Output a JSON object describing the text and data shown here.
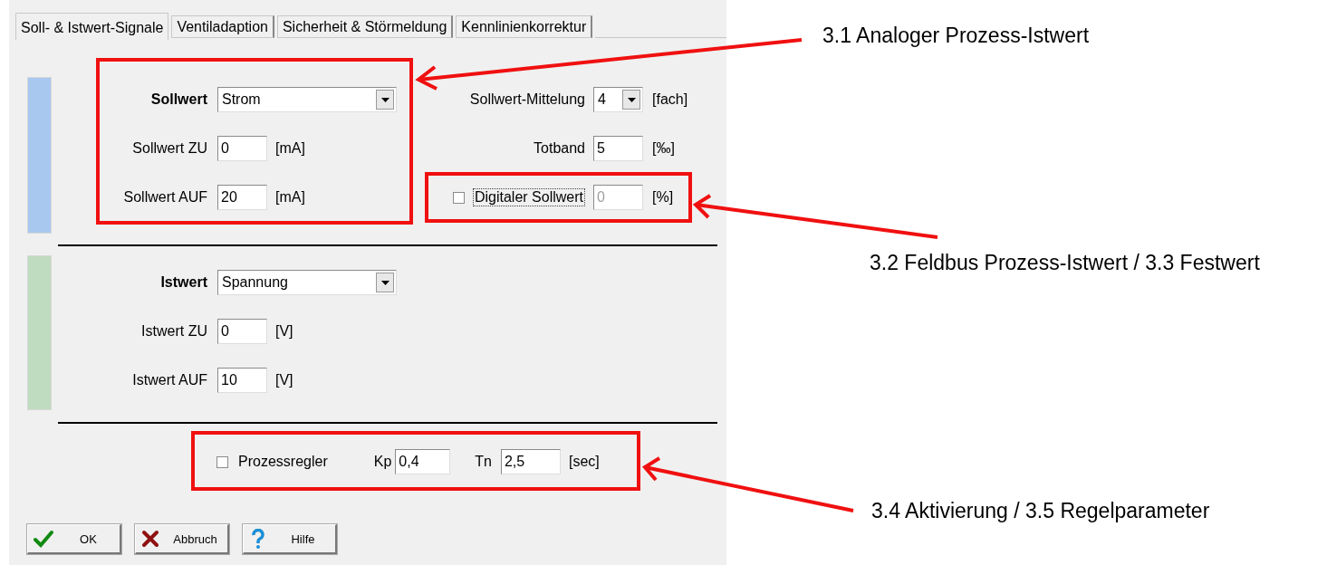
{
  "tabs": [
    {
      "label": "Soll- & Istwert-Signale",
      "selected": true
    },
    {
      "label": "Ventiladaption",
      "selected": false
    },
    {
      "label": "Sicherheit & Störmeldung",
      "selected": false
    },
    {
      "label": "Kennlinienkorrektur",
      "selected": false
    }
  ],
  "setpoint": {
    "label": "Sollwert",
    "source": "Strom",
    "rows": [
      {
        "label": "Sollwert ZU",
        "value": "0",
        "unit": "[mA]"
      },
      {
        "label": "Sollwert AUF",
        "value": "20",
        "unit": "[mA]"
      }
    ]
  },
  "averaging": {
    "label": "Sollwert-Mittelung",
    "value": "4",
    "unit": "[fach]"
  },
  "deadband": {
    "label": "Totband",
    "value": "5",
    "unit": "[‰]"
  },
  "digital_setpoint": {
    "label": "Digitaler Sollwert",
    "checked": false,
    "value": "0",
    "unit": "[%]"
  },
  "actual": {
    "label": "Istwert",
    "source": "Spannung",
    "rows": [
      {
        "label": "Istwert ZU",
        "value": "0",
        "unit": "[V]"
      },
      {
        "label": "Istwert AUF",
        "value": "10",
        "unit": "[V]"
      }
    ]
  },
  "controller": {
    "label": "Prozessregler",
    "checked": false,
    "kp_label": "Kp",
    "kp": "0,4",
    "tn_label": "Tn",
    "tn": "2,5",
    "unit": "[sec]"
  },
  "buttons": [
    {
      "label": "OK",
      "kind": "ok"
    },
    {
      "label": "Abbruch",
      "kind": "cancel"
    },
    {
      "label": "Hilfe",
      "kind": "help"
    }
  ],
  "annotations": [
    "3.1 Analoger Prozess-Istwert",
    "3.2 Feldbus Prozess-Istwert / 3.3 Festwert",
    "3.4 Aktivierung / 3.5 Regelparameter"
  ]
}
